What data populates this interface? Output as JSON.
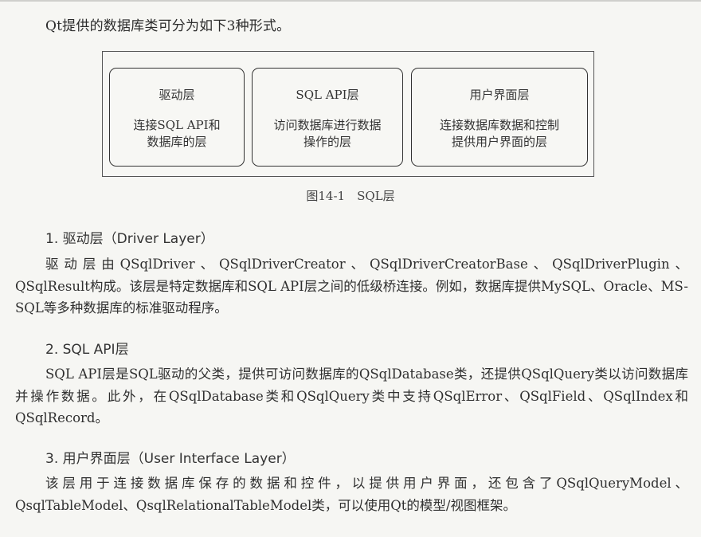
{
  "intro": "Qt提供的数据库类可分为如下3种形式。",
  "diagram": {
    "boxes": [
      {
        "title": "驱动层",
        "desc_line1": "连接SQL API和",
        "desc_line2": "数据库的层"
      },
      {
        "title": "SQL API层",
        "desc_line1": "访问数据库进行数据",
        "desc_line2": "操作的层"
      },
      {
        "title": "用户界面层",
        "desc_line1": "连接数据库数据和控制",
        "desc_line2": "提供用户界面的层"
      }
    ],
    "caption": "图14-1　SQL层"
  },
  "sections": [
    {
      "heading": "1. 驱动层（Driver Layer）",
      "body": "驱动层由QSqlDriver、QSqlDriverCreator、QSqlDriverCreatorBase、QSqlDriverPlugin、QSqlResult构成。该层是特定数据库和SQL API层之间的低级桥连接。例如，数据库提供MySQL、Oracle、MS-SQL等多种数据库的标准驱动程序。"
    },
    {
      "heading": "2. SQL API层",
      "body": "SQL API层是SQL驱动的父类，提供可访问数据库的QSqlDatabase类，还提供QSqlQuery类以访问数据库并操作数据。此外，在QSqlDatabase类和QSqlQuery类中支持QSqlError、QSqlField、QSqlIndex和QSqlRecord。"
    },
    {
      "heading": "3. 用户界面层（User Interface Layer）",
      "body": "该层用于连接数据库保存的数据和控件，以提供用户界面，还包含了QSqlQueryModel、QsqlTableModel、QsqlRelationalTableModel类，可以使用Qt的模型/视图框架。"
    }
  ]
}
